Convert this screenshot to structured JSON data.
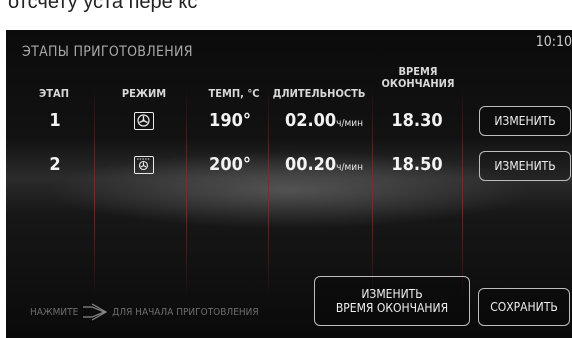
{
  "caption": "отсчету уста пере кс",
  "header": {
    "title": "ЭТАПЫ ПРИГОТОВЛЕНИЯ",
    "clock": "10:10"
  },
  "columns": {
    "stage": "ЭТАП",
    "mode": "РЕЖИМ",
    "temp": "ТЕМП, °С",
    "duration": "ДЛИТЕЛЬНОСТЬ",
    "end_time_line1": "ВРЕМЯ",
    "end_time_line2": "ОКОНЧАНИЯ"
  },
  "rows": [
    {
      "stage": "1",
      "mode_icon": "fan-mode-icon",
      "temp": "190°",
      "duration": "02.00",
      "duration_unit": "ч/мин",
      "end_time": "18.30",
      "edit_label": "ИЗМЕНИТЬ"
    },
    {
      "stage": "2",
      "mode_icon": "grill-fan-mode-icon",
      "temp": "200°",
      "duration": "00.20",
      "duration_unit": "ч/мин",
      "end_time": "18.50",
      "edit_label": "ИЗМЕНИТЬ"
    }
  ],
  "footer": {
    "hint_press": "НАЖМИТЕ",
    "hint_rest": "ДЛЯ НАЧАЛА ПРИГОТОВЛЕНИЯ",
    "change_end_line1": "ИЗМЕНИТЬ",
    "change_end_line2": "ВРЕМЯ ОКОНЧАНИЯ",
    "save": "СОХРАНИТЬ"
  },
  "colors": {
    "accent_line": "#aa1919",
    "text": "#f2f2f2",
    "dim_text": "#6e6e6e"
  }
}
